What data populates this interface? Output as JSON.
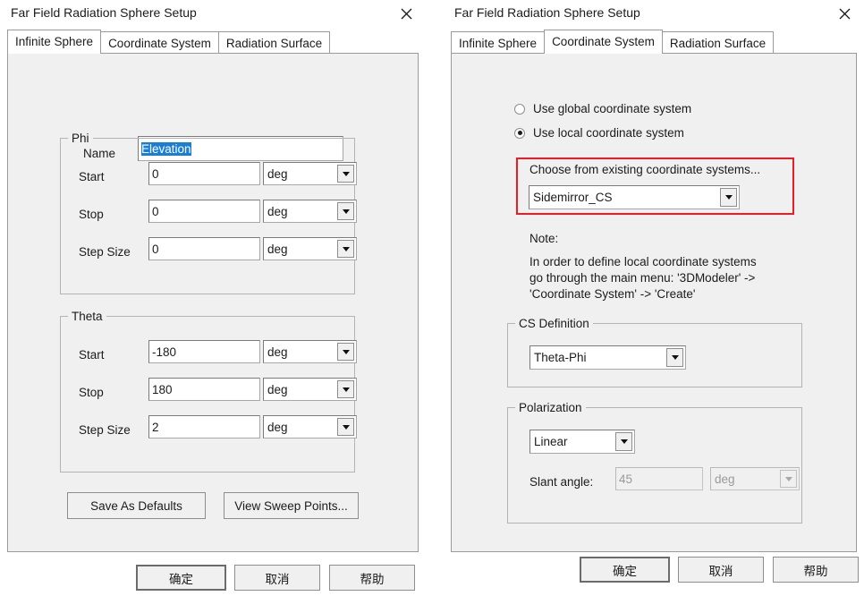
{
  "left_dialog": {
    "title": "Far Field Radiation Sphere Setup",
    "close_icon": "close-icon",
    "tabs": [
      {
        "label": "Infinite Sphere",
        "active": true
      },
      {
        "label": "Coordinate System",
        "active": false
      },
      {
        "label": "Radiation Surface",
        "active": false
      }
    ],
    "name_label": "Name",
    "name_value": "Elevation",
    "phi": {
      "title": "Phi",
      "rows": [
        {
          "label": "Start",
          "value": "0",
          "unit": "deg"
        },
        {
          "label": "Stop",
          "value": "0",
          "unit": "deg"
        },
        {
          "label": "Step Size",
          "value": "0",
          "unit": "deg"
        }
      ]
    },
    "theta": {
      "title": "Theta",
      "rows": [
        {
          "label": "Start",
          "value": "-180",
          "unit": "deg"
        },
        {
          "label": "Stop",
          "value": "180",
          "unit": "deg"
        },
        {
          "label": "Step Size",
          "value": "2",
          "unit": "deg"
        }
      ]
    },
    "save_defaults_label": "Save As Defaults",
    "view_sweep_label": "View Sweep Points...",
    "footer": {
      "ok": "确定",
      "cancel": "取消",
      "help": "帮助"
    }
  },
  "right_dialog": {
    "title": "Far Field Radiation Sphere Setup",
    "close_icon": "close-icon",
    "tabs": [
      {
        "label": "Infinite Sphere",
        "active": false
      },
      {
        "label": "Coordinate System",
        "active": true
      },
      {
        "label": "Radiation Surface",
        "active": false
      }
    ],
    "radios": [
      {
        "label": "Use global coordinate system",
        "selected": false
      },
      {
        "label": "Use local coordinate system",
        "selected": true
      }
    ],
    "choose_cs_label": "Choose from existing coordinate systems...",
    "cs_value": "Sidemirror_CS",
    "highlight_color": "#ee1b24",
    "note_title": "Note:",
    "note_body": "In order to define local coordinate systems\ngo through the main menu: '3DModeler' ->\n'Coordinate System' -> 'Create'",
    "cs_definition": {
      "title": "CS Definition",
      "value": "Theta-Phi"
    },
    "polarization": {
      "title": "Polarization",
      "value": "Linear",
      "slant_label": "Slant angle:",
      "slant_value": "45",
      "slant_unit": "deg",
      "slant_disabled": true
    },
    "footer": {
      "ok": "确定",
      "cancel": "取消",
      "help": "帮助"
    }
  }
}
